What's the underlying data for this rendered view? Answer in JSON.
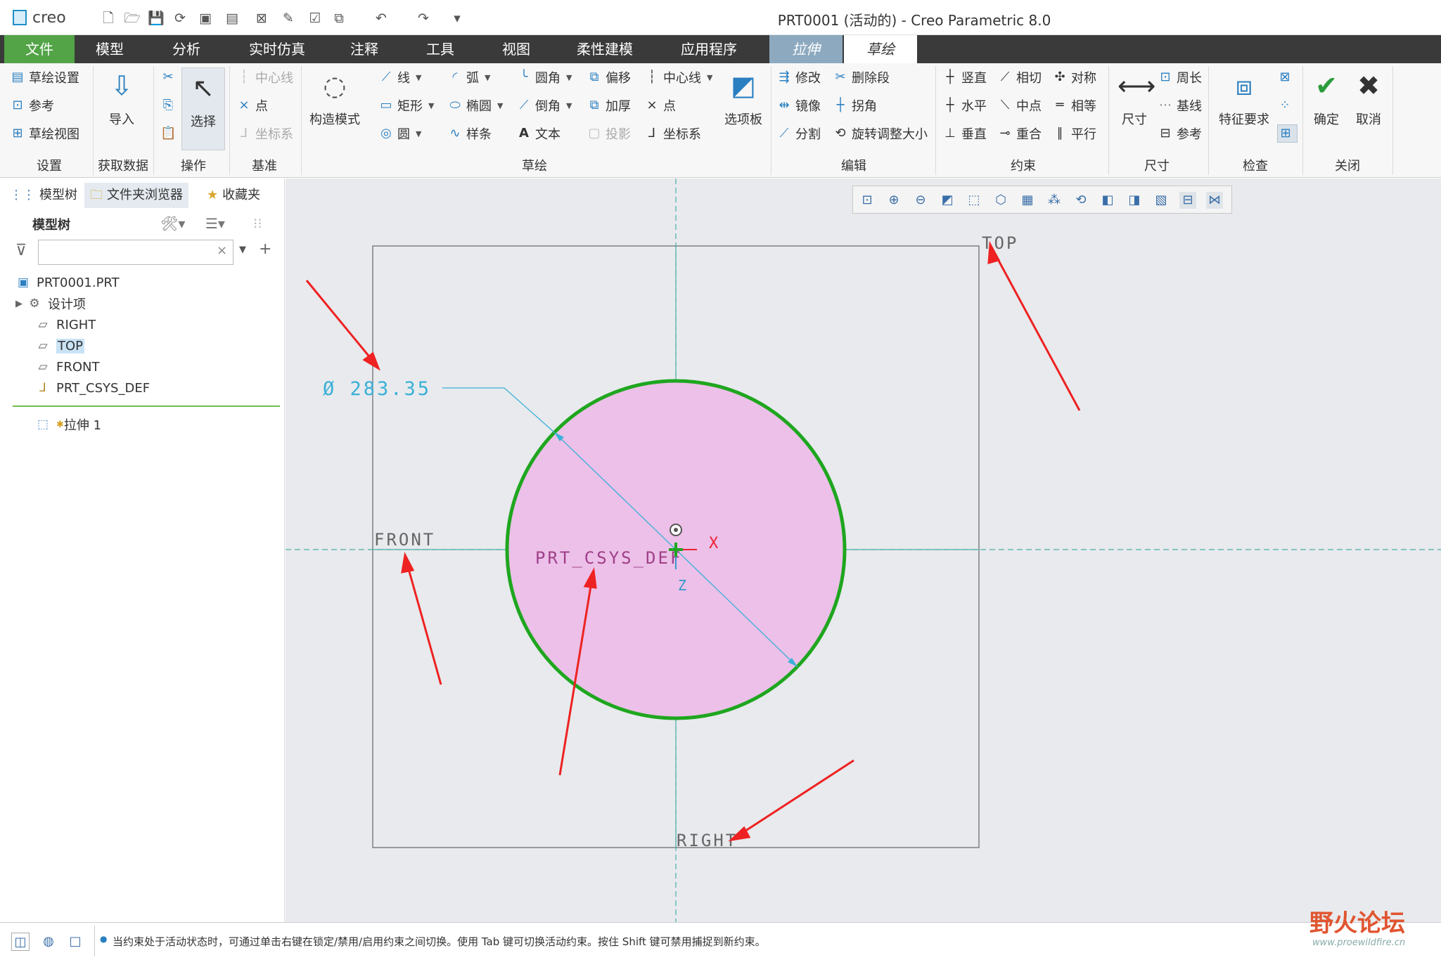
{
  "titlebar": {
    "logo_text": "creo",
    "window_title": "PRT0001 (活动的) - Creo Parametric 8.0"
  },
  "tabs": [
    "文件",
    "模型",
    "分析",
    "实时仿真",
    "注释",
    "工具",
    "视图",
    "柔性建模",
    "应用程序",
    "拉伸",
    "草绘"
  ],
  "ribbon": {
    "setup": {
      "items": [
        "草绘设置",
        "参考",
        "草绘视图"
      ],
      "title": "设置"
    },
    "get_data": {
      "import": "导入",
      "title": "获取数据"
    },
    "operations": {
      "select": "选择",
      "title": "操作"
    },
    "datum": {
      "items": [
        "中心线",
        "点",
        "坐标系"
      ],
      "title": "基准"
    },
    "sketch": {
      "construct_mode": "构造模式",
      "col1": [
        "线",
        "矩形",
        "圆"
      ],
      "col2": [
        "弧",
        "椭圆",
        "样条"
      ],
      "col3": [
        "圆角",
        "倒角",
        "文本"
      ],
      "col4": [
        "偏移",
        "加厚",
        "投影"
      ],
      "col5": [
        "中心线",
        "点",
        "坐标系"
      ],
      "palette": "选项板",
      "title": "草绘"
    },
    "edit": {
      "items": [
        "修改",
        "删除段",
        "镜像",
        "拐角",
        "分割",
        "旋转调整大小"
      ],
      "title": "编辑"
    },
    "constrain": {
      "items": [
        "竖直",
        "相切",
        "对称",
        "水平",
        "中点",
        "相等",
        "垂直",
        "重合",
        "平行"
      ],
      "title": "约束"
    },
    "dimension": {
      "dim": "尺寸",
      "items": [
        "周长",
        "基线",
        "参考"
      ],
      "title": "尺寸"
    },
    "inspect": {
      "feature_req": "特征要求",
      "title": "检查"
    },
    "close": {
      "ok": "确定",
      "cancel": "取消",
      "title": "关闭"
    }
  },
  "left_panel": {
    "tabs": [
      "模型树",
      "文件夹浏览器",
      "收藏夹"
    ],
    "tree_title": "模型树",
    "tree": [
      "PRT0001.PRT",
      "设计项",
      "RIGHT",
      "TOP",
      "FRONT",
      "PRT_CSYS_DEF"
    ],
    "feature": "拉伸 1"
  },
  "canvas": {
    "dimension": "Ø 283.35",
    "plane_top": "TOP",
    "plane_front": "FRONT",
    "plane_right": "RIGHT",
    "csys": "PRT_CSYS_DEF",
    "axis_x": "X",
    "axis_z": "Z",
    "colors": {
      "circle": "#1fa61f",
      "fill": "#ecc0e8",
      "dimension": "#3ab0d8",
      "arrow": "#ee2222"
    }
  },
  "statusbar": {
    "message": "当约束处于活动状态时，可通过单击右键在锁定/禁用/启用约束之间切换。使用 Tab 键可切换活动约束。按住 Shift 键可禁用捕捉到新约束。"
  },
  "watermark": {
    "text": "野火论坛",
    "url": "www.proewildfire.cn"
  }
}
